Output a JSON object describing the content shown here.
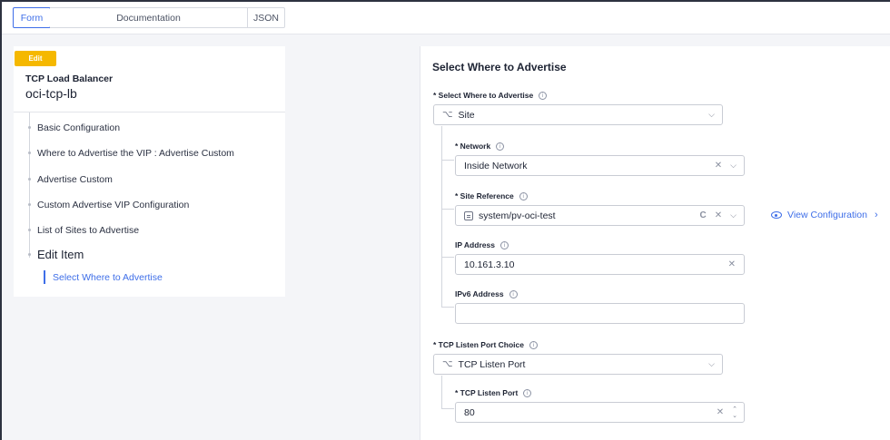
{
  "tabs": {
    "form": "Form",
    "documentation": "Documentation",
    "json": "JSON"
  },
  "object": {
    "badge": "Edit",
    "type": "TCP Load Balancer",
    "name": "oci-tcp-lb"
  },
  "nav": {
    "items": [
      "Basic Configuration",
      "Where to Advertise the VIP : Advertise Custom",
      "Advertise Custom",
      "Custom Advertise VIP Configuration",
      "List of Sites to Advertise",
      "Edit Item"
    ],
    "active": "Select Where to Advertise"
  },
  "form": {
    "section_title": "Select Where to Advertise",
    "where": {
      "label": "* Select Where to Advertise",
      "value": "Site"
    },
    "network": {
      "label": "* Network",
      "value": "Inside Network"
    },
    "site_ref": {
      "label": "* Site Reference",
      "value": "system/pv-oci-test",
      "view_link": "View Configuration"
    },
    "ip": {
      "label": "IP Address",
      "value": "10.161.3.10"
    },
    "ipv6": {
      "label": "IPv6 Address",
      "value": ""
    },
    "port_choice": {
      "label": "* TCP Listen Port Choice",
      "value": "TCP Listen Port"
    },
    "port": {
      "label": "* TCP Listen Port",
      "value": "80"
    }
  },
  "icons": {
    "info": "i",
    "clear": "✕",
    "chevron": "⌵",
    "refresh": "C",
    "choice": "⌥",
    "up": "⌃",
    "down": "⌄",
    "right": "›"
  },
  "colors": {
    "accent": "#3e6ee8",
    "badge": "#f5b800"
  }
}
